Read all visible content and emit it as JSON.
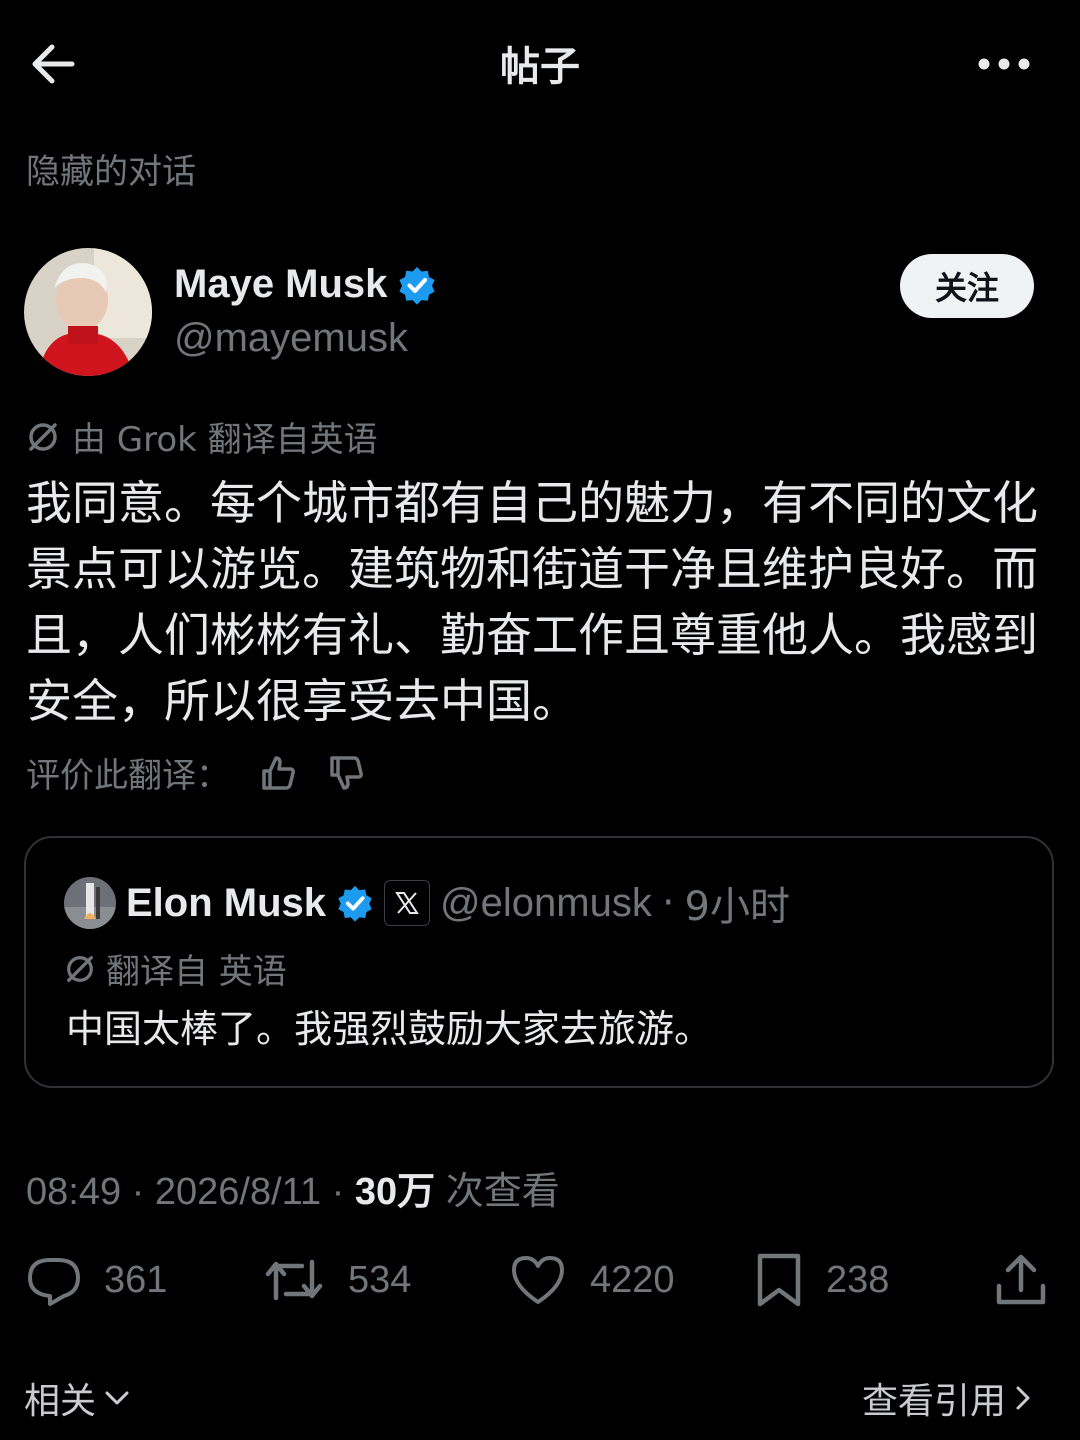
{
  "header": {
    "title": "帖子",
    "back_icon": "arrow-left-icon",
    "more_icon": "more-horizontal-icon"
  },
  "hidden_conversation": "隐藏的对话",
  "author": {
    "name": "Maye Musk",
    "handle": "@mayemusk",
    "verified_color": "#1d9bf0",
    "follow_label": "关注"
  },
  "translation": {
    "grok_label": "由 Grok 翻译自英语"
  },
  "post": {
    "body": "我同意。每个城市都有自己的魅力，有不同的文化景点可以游览。建筑物和街道干净且维护良好。而且，人们彬彬有礼、勤奋工作且尊重他人。我感到安全，所以很享受去中国。"
  },
  "rate": {
    "label": "评价此翻译："
  },
  "quote": {
    "name": "Elon Musk",
    "handle": "@elonmusk",
    "separator": "·",
    "time": "9小时",
    "translated_label": "翻译自 英语",
    "text": "中国太棒了。我强烈鼓励大家去旅游。"
  },
  "meta": {
    "time": "08:49",
    "date": "2026/8/11",
    "views": "30万",
    "views_label": "次查看",
    "sep": " · "
  },
  "actions": {
    "replies": "361",
    "retweets": "534",
    "likes": "4220",
    "bookmarks": "238"
  },
  "footer": {
    "related": "相关",
    "view_quotes": "查看引用"
  }
}
